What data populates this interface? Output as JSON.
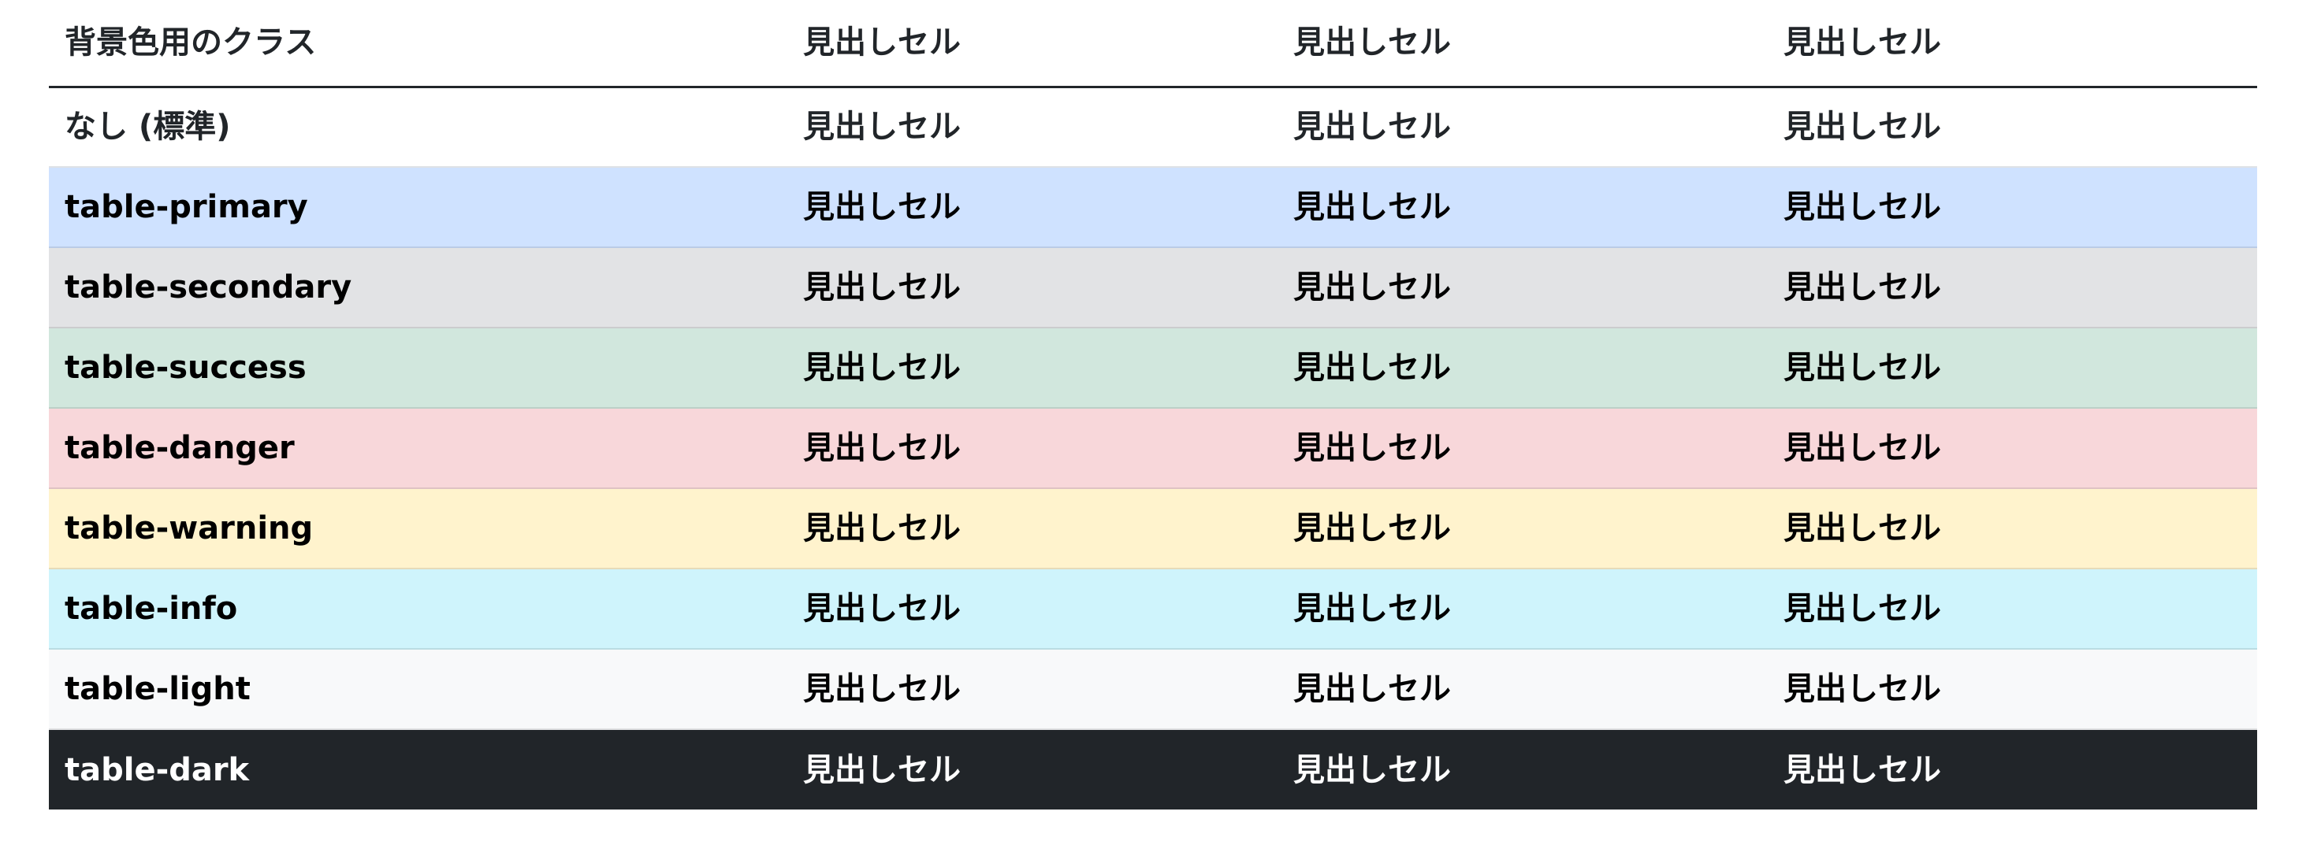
{
  "table": {
    "header": [
      "背景色用のクラス",
      "見出しセル",
      "見出しセル",
      "見出しセル"
    ],
    "rows": [
      {
        "label": "なし (標準)",
        "cells": [
          "見出しセル",
          "見出しセル",
          "見出しセル"
        ],
        "bg": "#ffffff",
        "color": "#212529",
        "border": "#dee2e6"
      },
      {
        "label": "table-primary",
        "cells": [
          "見出しセル",
          "見出しセル",
          "見出しセル"
        ],
        "bg": "#cfe2ff",
        "color": "#000000",
        "border": "#bacbe6"
      },
      {
        "label": "table-secondary",
        "cells": [
          "見出しセル",
          "見出しセル",
          "見出しセル"
        ],
        "bg": "#e2e3e5",
        "color": "#000000",
        "border": "#cbccce"
      },
      {
        "label": "table-success",
        "cells": [
          "見出しセル",
          "見出しセル",
          "見出しセル"
        ],
        "bg": "#d1e7dd",
        "color": "#000000",
        "border": "#bcd0c7"
      },
      {
        "label": "table-danger",
        "cells": [
          "見出しセル",
          "見出しセル",
          "見出しセル"
        ],
        "bg": "#f8d7da",
        "color": "#000000",
        "border": "#dfc2c4"
      },
      {
        "label": "table-warning",
        "cells": [
          "見出しセル",
          "見出しセル",
          "見出しセル"
        ],
        "bg": "#fff3cd",
        "color": "#000000",
        "border": "#e6dbb9"
      },
      {
        "label": "table-info",
        "cells": [
          "見出しセル",
          "見出しセル",
          "見出しセル"
        ],
        "bg": "#cff4fc",
        "color": "#000000",
        "border": "#badce3"
      },
      {
        "label": "table-light",
        "cells": [
          "見出しセル",
          "見出しセル",
          "見出しセル"
        ],
        "bg": "#f8f9fa",
        "color": "#000000",
        "border": "#dfe0e1"
      },
      {
        "label": "table-dark",
        "cells": [
          "見出しセル",
          "見出しセル",
          "見出しセル"
        ],
        "bg": "#212529",
        "color": "#ffffff",
        "border": "#373b3e"
      }
    ]
  }
}
